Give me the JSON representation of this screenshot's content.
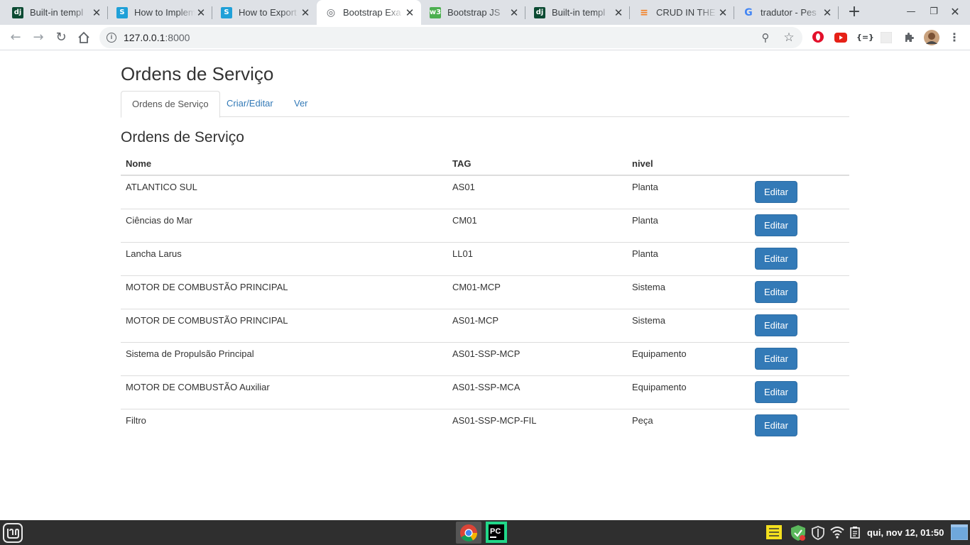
{
  "browser": {
    "tabs": [
      {
        "title": "Built-in templ",
        "favicon": "django-icon",
        "color": "#0c4b33",
        "glyph": "dj"
      },
      {
        "title": "How to Implem",
        "favicon": "s-icon",
        "color": "#1fa0d8",
        "glyph": "S"
      },
      {
        "title": "How to Export",
        "favicon": "s-icon",
        "color": "#1fa0d8",
        "glyph": "S"
      },
      {
        "title": "Bootstrap Exa",
        "favicon": "globe-icon",
        "color": "#5f6368",
        "glyph": "◎",
        "active": true
      },
      {
        "title": "Bootstrap JS",
        "favicon": "w3-icon",
        "color": "#4caf50",
        "glyph": "w3"
      },
      {
        "title": "Built-in templ",
        "favicon": "django-icon",
        "color": "#0c4b33",
        "glyph": "dj"
      },
      {
        "title": "CRUD IN THE D",
        "favicon": "stackoverflow-icon",
        "color": "#f48024",
        "glyph": "≡"
      },
      {
        "title": "tradutor - Pes",
        "favicon": "google-icon",
        "color": "#4285f4",
        "glyph": "G"
      }
    ],
    "url_host": "127.0.0.1",
    "url_port": ":8000"
  },
  "page": {
    "title": "Ordens de Serviço",
    "nav_tabs": [
      "Ordens de Serviço",
      "Criar/Editar",
      "Ver"
    ],
    "section_title": "Ordens de Serviço",
    "table": {
      "headers": [
        "Nome",
        "TAG",
        "nivel",
        ""
      ],
      "rows": [
        {
          "nome": "ATLANTICO SUL",
          "tag": "AS01",
          "nivel": "Planta",
          "action": "Editar"
        },
        {
          "nome": "Ciências do Mar",
          "tag": "CM01",
          "nivel": "Planta",
          "action": "Editar"
        },
        {
          "nome": "Lancha Larus",
          "tag": "LL01",
          "nivel": "Planta",
          "action": "Editar"
        },
        {
          "nome": "MOTOR DE COMBUSTÃO PRINCIPAL",
          "tag": "CM01-MCP",
          "nivel": "Sistema",
          "action": "Editar"
        },
        {
          "nome": "MOTOR DE COMBUSTÃO PRINCIPAL",
          "tag": "AS01-MCP",
          "nivel": "Sistema",
          "action": "Editar"
        },
        {
          "nome": "Sistema de Propulsão Principal",
          "tag": "AS01-SSP-MCP",
          "nivel": "Equipamento",
          "action": "Editar"
        },
        {
          "nome": "MOTOR DE COMBUSTÃO Auxiliar",
          "tag": "AS01-SSP-MCA",
          "nivel": "Equipamento",
          "action": "Editar"
        },
        {
          "nome": "Filtro",
          "tag": "AS01-SSP-MCP-FIL",
          "nivel": "Peça",
          "action": "Editar"
        }
      ]
    }
  },
  "taskbar": {
    "clock": "qui, nov 12, 01:50"
  },
  "colors": {
    "primary": "#337ab7",
    "link": "#337ab7",
    "tabstrip": "#dee1e6",
    "taskbar": "#2f2f2f"
  }
}
